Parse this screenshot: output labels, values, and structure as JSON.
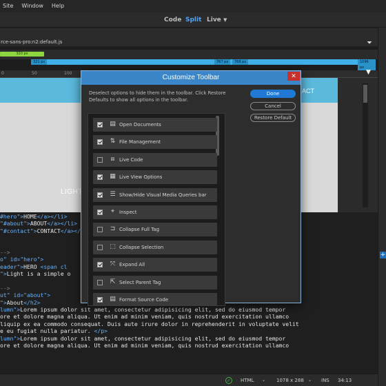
{
  "menu": [
    "Site",
    "Window",
    "Help"
  ],
  "views": {
    "code": "Code",
    "split": "Split",
    "live": "Live"
  },
  "path_text": "rce-sans-pro:n2:default.js",
  "mq": {
    "green": "320 px",
    "blue_left": "321 px",
    "blue_mid1": "767 px",
    "blue_mid2": "768 px",
    "blue_right": "1096 px"
  },
  "ruler": [
    "0",
    "50",
    "100",
    "150"
  ],
  "preview": {
    "contact": "ACT",
    "light": "LIGHT"
  },
  "code_lines": [
    [
      [
        "tag",
        "#hero\">"
      ],
      [
        "txt",
        "HOME"
      ],
      [
        "tag",
        "</a></li>"
      ]
    ],
    [
      [
        "tag",
        "\"#about\">"
      ],
      [
        "txt",
        "ABOUT"
      ],
      [
        "tag",
        "</a></li>"
      ]
    ],
    [
      [
        "tag",
        "\"#contact\">"
      ],
      [
        "txt",
        "CONTACT"
      ],
      [
        "tag",
        "</a></li>"
      ]
    ],
    [
      [
        "txt",
        ""
      ]
    ],
    [
      [
        "txt",
        ""
      ]
    ],
    [
      [
        "cmt",
        "-->"
      ]
    ],
    [
      [
        "tag",
        "o\" id=\"hero\">"
      ]
    ],
    [
      [
        "tag",
        "eader\">"
      ],
      [
        "txt",
        "HERO "
      ],
      [
        "tag",
        "<span cl"
      ]
    ],
    [
      [
        "tag",
        "\">"
      ],
      [
        "txt",
        "Light is a simple o"
      ]
    ],
    [
      [
        "txt",
        ""
      ]
    ],
    [
      [
        "cmt",
        "-->"
      ]
    ],
    [
      [
        "tag",
        "ut\" id=\"about\">"
      ]
    ],
    [
      [
        "tag",
        "\">"
      ],
      [
        "txt",
        "About"
      ],
      [
        "tag",
        "</h2>"
      ]
    ],
    [
      [
        "tag",
        "lumn\">"
      ],
      [
        "txt",
        "Lorem ipsum dolor sit amet, consectetur adipisicing elit, sed do eiusmod tempor"
      ]
    ],
    [
      [
        "txt",
        "ore et dolore magna aliqua. Ut enim ad minim veniam, quis nostrud exercitation ullamco"
      ]
    ],
    [
      [
        "txt",
        "liquip ex ea commodo consequat. Duis aute irure dolor in reprehenderit in voluptate velit"
      ]
    ],
    [
      [
        "txt",
        "e eu fugiat nulla pariatur. "
      ],
      [
        "tag",
        "</p>"
      ]
    ],
    [
      [
        "tag",
        "lumn\">"
      ],
      [
        "txt",
        "Lorem ipsum dolor sit amet, consectetur adipisicing elit, sed do eiusmod tempor"
      ]
    ],
    [
      [
        "txt",
        "ore et dolore magna aliqua. Ut enim ad minim veniam, quis nostrud exercitation ullamco"
      ]
    ]
  ],
  "status": {
    "lang": "HTML",
    "size": "1078 x 288",
    "mode": "INS",
    "pos": "34:13"
  },
  "dialog": {
    "title": "Customize Toolbar",
    "description": "Deselect options to hide them in the toolbar. Click Restore Defaults to show all options in the toolbar.",
    "done": "Done",
    "cancel": "Cancel",
    "restore": "Restore Default",
    "options": [
      {
        "label": "Open Documents",
        "checked": true,
        "icon": "documents-icon",
        "glyph": "▤"
      },
      {
        "label": "File Management",
        "checked": true,
        "icon": "file-transfer-icon",
        "glyph": "⇅"
      },
      {
        "label": "Live Code",
        "checked": false,
        "icon": "live-code-icon",
        "glyph": "⧈"
      },
      {
        "label": "Live View Options",
        "checked": true,
        "icon": "live-view-options-icon",
        "glyph": "▦"
      },
      {
        "label": "Show/Hide Visual Media Queries bar",
        "checked": true,
        "icon": "media-queries-icon",
        "glyph": "☰"
      },
      {
        "label": "Inspect",
        "checked": true,
        "icon": "inspect-icon",
        "glyph": "⌖"
      },
      {
        "label": "Collapse Full Tag",
        "checked": false,
        "icon": "collapse-tag-icon",
        "glyph": "⊐"
      },
      {
        "label": "Collapse Selection",
        "checked": false,
        "icon": "collapse-selection-icon",
        "glyph": "⬚"
      },
      {
        "label": "Expand All",
        "checked": true,
        "icon": "expand-all-icon",
        "glyph": "⤧"
      },
      {
        "label": "Select Parent Tag",
        "checked": false,
        "icon": "select-parent-icon",
        "glyph": "⇱"
      },
      {
        "label": "Format Source Code",
        "checked": true,
        "icon": "format-code-icon",
        "glyph": "▤"
      }
    ]
  }
}
